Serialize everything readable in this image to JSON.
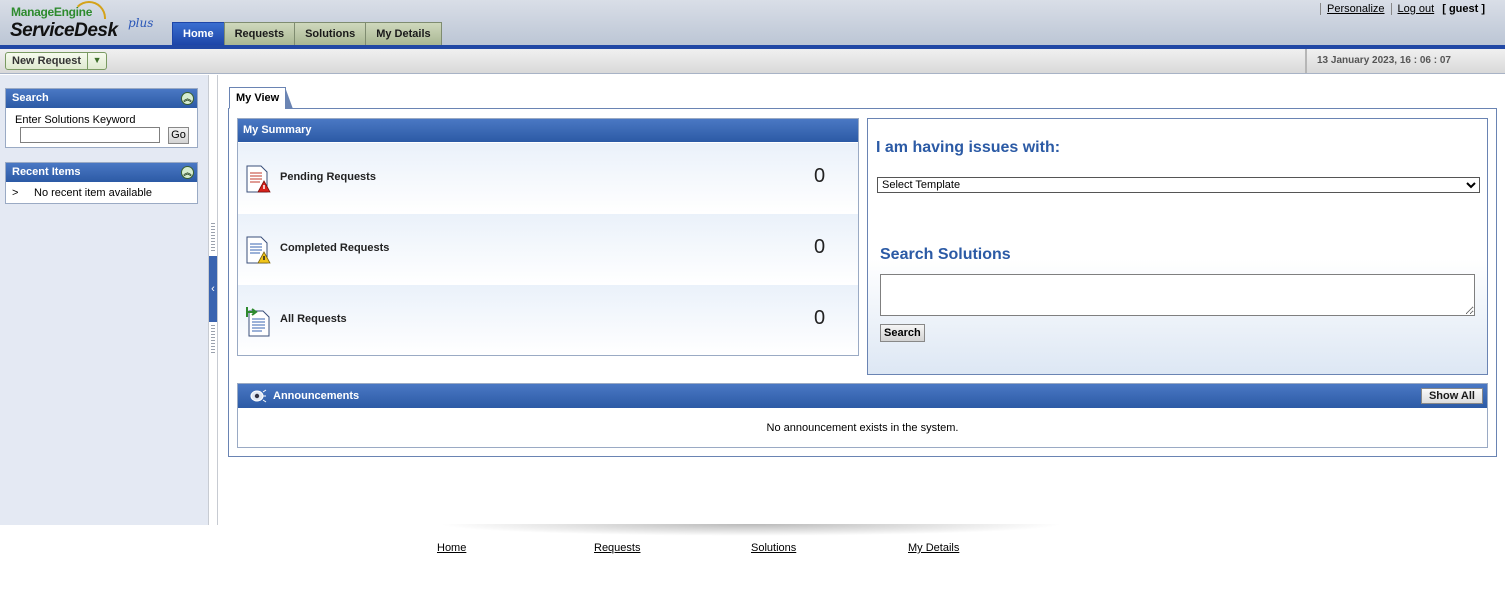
{
  "header": {
    "logo_top": "ManageEngine",
    "logo_main": "ServiceDesk",
    "logo_plus": "plus",
    "tabs": [
      {
        "label": "Home",
        "active": true
      },
      {
        "label": "Requests",
        "active": false
      },
      {
        "label": "Solutions",
        "active": false
      },
      {
        "label": "My Details",
        "active": false
      }
    ],
    "personalize": "Personalize",
    "logout": "Log out",
    "user": "[ guest ]"
  },
  "toolbar": {
    "new_request": "New Request",
    "datetime": "13 January 2023, 16 : 06 : 07"
  },
  "sidebar": {
    "search_title": "Search",
    "search_label": "Enter Solutions Keyword",
    "search_value": "",
    "go": "Go",
    "recent_title": "Recent Items",
    "recent_marker": ">",
    "recent_empty": "No recent item available"
  },
  "main": {
    "view_tab": "My View",
    "summary": {
      "title": "My Summary",
      "rows": [
        {
          "label": "Pending Requests",
          "count": "0",
          "icon": "pending-requests-icon"
        },
        {
          "label": "Completed Requests",
          "count": "0",
          "icon": "completed-requests-icon"
        },
        {
          "label": "All Requests",
          "count": "0",
          "icon": "all-requests-icon"
        }
      ]
    },
    "issues": {
      "title": "I am having issues with:",
      "template_selected": "Select Template",
      "search_title": "Search Solutions",
      "search_value": "",
      "search_button": "Search"
    },
    "announcements": {
      "title": "Announcements",
      "show_all": "Show All",
      "empty": "No announcement exists in the system."
    }
  },
  "footer": {
    "links": [
      "Home",
      "Requests",
      "Solutions",
      "My Details"
    ]
  },
  "colors": {
    "accent_blue": "#2c5aa5",
    "header_line": "#2148a5",
    "title_blue": "#2b5aa5"
  }
}
